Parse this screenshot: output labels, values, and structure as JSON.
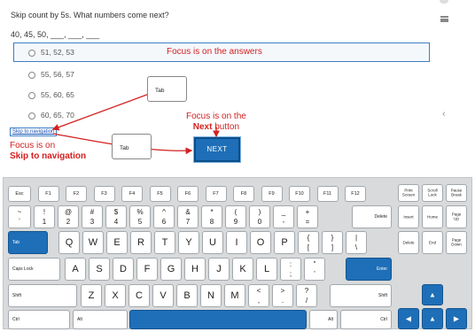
{
  "quiz": {
    "question": "Skip count by 5s. What numbers come next?",
    "sequence": "40, 45, 50, ___, ___, ___",
    "options": [
      "51, 52, 53",
      "55, 56, 57",
      "55, 60, 65",
      "60, 65, 70"
    ],
    "focused_option_index": 0,
    "skip_link": "Skip to navigation",
    "next_button": "NEXT"
  },
  "annotations": {
    "focus_answers": "Focus is on the answers",
    "focus_next_line1": "Focus is on the",
    "focus_next_bold": "Next",
    "focus_next_suffix": " button",
    "focus_skip_line1": "Focus is on",
    "focus_skip_bold": "Skip to navigation",
    "tab_label": "Tab",
    "color": "#d42020"
  },
  "keyboard": {
    "fn_row": [
      "Esc",
      "F1",
      "F2",
      "F3",
      "F4",
      "F5",
      "F6",
      "F7",
      "F8",
      "F9",
      "F10",
      "F11",
      "F12"
    ],
    "nav_top": [
      "Print\nScreen",
      "Scroll\nLock",
      "Pause\nBreak"
    ],
    "num_row": [
      {
        "top": "~",
        "bot": "`"
      },
      {
        "top": "!",
        "bot": "1"
      },
      {
        "top": "@",
        "bot": "2"
      },
      {
        "top": "#",
        "bot": "3"
      },
      {
        "top": "$",
        "bot": "4"
      },
      {
        "top": "%",
        "bot": "5"
      },
      {
        "top": "^",
        "bot": "6"
      },
      {
        "top": "&",
        "bot": "7"
      },
      {
        "top": "*",
        "bot": "8"
      },
      {
        "top": "(",
        "bot": "9"
      },
      {
        "top": ")",
        "bot": "0"
      },
      {
        "top": "_",
        "bot": "-"
      },
      {
        "top": "+",
        "bot": "="
      }
    ],
    "delete": "Delete",
    "nav_mid": [
      "Insert",
      "Home",
      "Page\nUp"
    ],
    "tab": "Tab",
    "row_q": [
      "Q",
      "W",
      "E",
      "R",
      "T",
      "Y",
      "U",
      "I",
      "O",
      "P"
    ],
    "row_q_sym": [
      {
        "top": "{",
        "bot": "["
      },
      {
        "top": "}",
        "bot": "]"
      },
      {
        "top": "|",
        "bot": "\\"
      }
    ],
    "nav_low": [
      "Delete",
      "End",
      "Page\nDown"
    ],
    "caps": "Caps Lock",
    "row_a": [
      "A",
      "S",
      "D",
      "F",
      "G",
      "H",
      "J",
      "K",
      "L"
    ],
    "row_a_sym": [
      {
        "top": ":",
        "bot": ";"
      },
      {
        "top": "\"",
        "bot": "'"
      }
    ],
    "enter": "Enter",
    "shift": "Shift",
    "row_z": [
      "Z",
      "X",
      "C",
      "V",
      "B",
      "N",
      "M"
    ],
    "row_z_sym": [
      {
        "top": "<",
        "bot": ","
      },
      {
        "top": ">",
        "bot": "."
      },
      {
        "top": "?",
        "bot": "/"
      }
    ],
    "ctrl": "Ctrl",
    "alt": "Alt",
    "arrows": {
      "up": "▲",
      "left": "◀",
      "down": "▲",
      "right": "▶"
    },
    "accent": "#1e6fb8"
  }
}
